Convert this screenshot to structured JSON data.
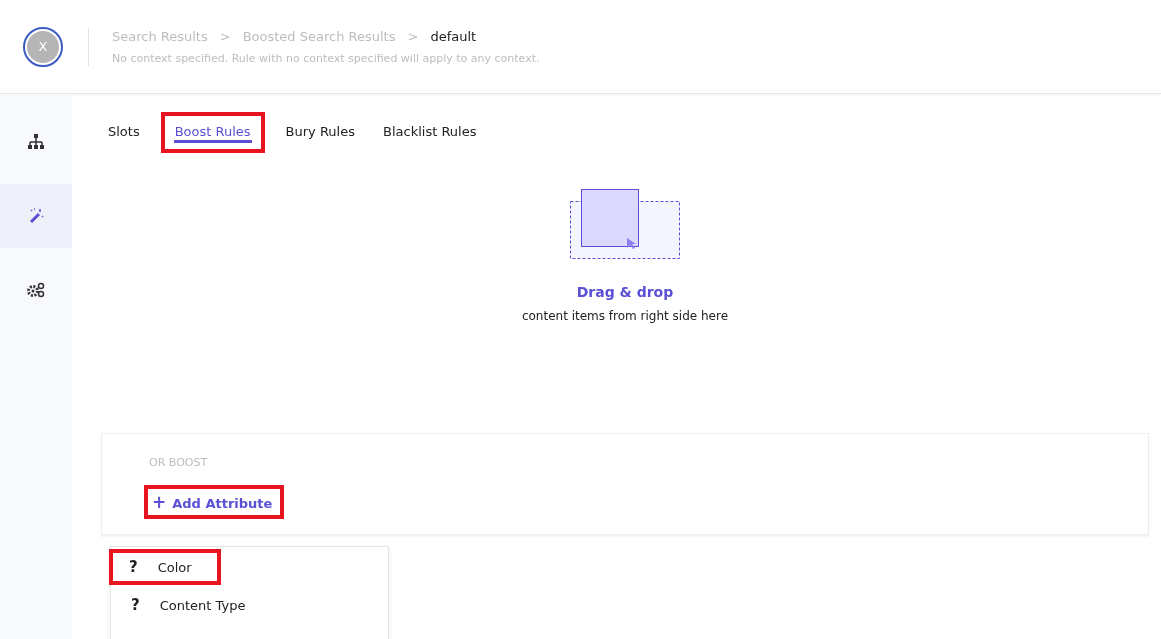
{
  "header": {
    "avatar": "X",
    "breadcrumb": [
      {
        "label": "Search Results",
        "current": false
      },
      {
        "label": ">",
        "current": false
      },
      {
        "label": "Boosted Search Results",
        "current": false
      },
      {
        "label": ">",
        "current": false
      },
      {
        "label": "default",
        "current": true
      }
    ],
    "subtitle": "No context specified. Rule with no context specified will apply to any context."
  },
  "sidebar": {
    "items": [
      {
        "kind": "hierarchy",
        "selected": false
      },
      {
        "kind": "wand",
        "selected": true
      },
      {
        "kind": "gears",
        "selected": false
      }
    ]
  },
  "tabs": [
    {
      "label": "Slots",
      "selected": false,
      "highlighted": false
    },
    {
      "label": "Boost Rules",
      "selected": true,
      "highlighted": true
    },
    {
      "label": "Bury Rules",
      "selected": false,
      "highlighted": false
    },
    {
      "label": "Blacklist Rules",
      "selected": false,
      "highlighted": false
    }
  ],
  "drop_zone": {
    "title": "Drag & drop",
    "text": "content items from right side here"
  },
  "boost_panel": {
    "label": "OR BOOST",
    "add_button": {
      "icon": "+",
      "label": "Add Attribute",
      "highlighted": true
    }
  },
  "attribute_menu": {
    "items": [
      {
        "icon": "?",
        "label": "Color",
        "highlighted": true
      },
      {
        "icon": "?",
        "label": "Content Type",
        "highlighted": false
      }
    ]
  }
}
